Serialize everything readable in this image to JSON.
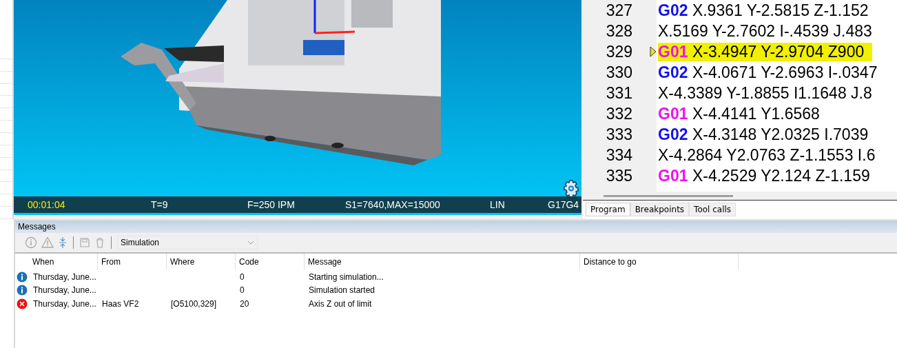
{
  "status_bar": {
    "time": "00:01:04",
    "tool": "T=9",
    "feed": "F=250 IPM",
    "spindle": "S1=7640,MAX=15000",
    "mode": "LIN",
    "codes": "G17G4"
  },
  "program": {
    "lines": [
      {
        "number": "327",
        "gcode": "G02",
        "kind": "arc",
        "rest": "X.9361 Y-2.5815 Z-1.152",
        "selected": false
      },
      {
        "number": "328",
        "kind": "none",
        "rest": "X.5169 Y-2.7602 I-.4539 J.483",
        "selected": false
      },
      {
        "number": "329",
        "gcode": "G01",
        "kind": "linear",
        "rest": "X-3.4947 Y-2.9704 Z900",
        "selected": true
      },
      {
        "number": "330",
        "gcode": "G02",
        "kind": "arc",
        "rest": "X-4.0671 Y-2.6963 I-.0347",
        "selected": false
      },
      {
        "number": "331",
        "kind": "none",
        "rest": "X-4.3389 Y-1.8855 I1.1648 J.8",
        "selected": false
      },
      {
        "number": "332",
        "gcode": "G01",
        "kind": "linear",
        "rest": "X-4.4141 Y1.6568",
        "selected": false
      },
      {
        "number": "333",
        "gcode": "G02",
        "kind": "arc",
        "rest": "X-4.3148 Y2.0325 I.7039",
        "selected": false
      },
      {
        "number": "334",
        "kind": "none",
        "rest": "X-4.2864 Y2.0763 Z-1.1553 I.6",
        "selected": false
      },
      {
        "number": "335",
        "gcode": "G01",
        "kind": "linear",
        "rest": "X-4.2529 Y2.124 Z-1.159",
        "selected": false
      }
    ],
    "tabs": [
      {
        "label": "Program",
        "selected": true
      },
      {
        "label": "Breakpoints",
        "selected": false
      },
      {
        "label": "Tool calls",
        "selected": false
      }
    ]
  },
  "messages": {
    "title": "Messages",
    "filter": "Simulation",
    "columns": [
      "When",
      "From",
      "Where",
      "Code",
      "Message",
      "Distance to go"
    ],
    "rows": [
      {
        "kind": "info",
        "when": "Thursday, June...",
        "code": "0",
        "message": "Starting simulation..."
      },
      {
        "kind": "info",
        "when": "Thursday, June...",
        "code": "0",
        "message": "Simulation started"
      },
      {
        "kind": "error",
        "when": "Thursday, June...",
        "from": "Haas VF2",
        "where": "[O5100,329]",
        "code": "20",
        "message": "Axis Z out of limit"
      }
    ]
  }
}
